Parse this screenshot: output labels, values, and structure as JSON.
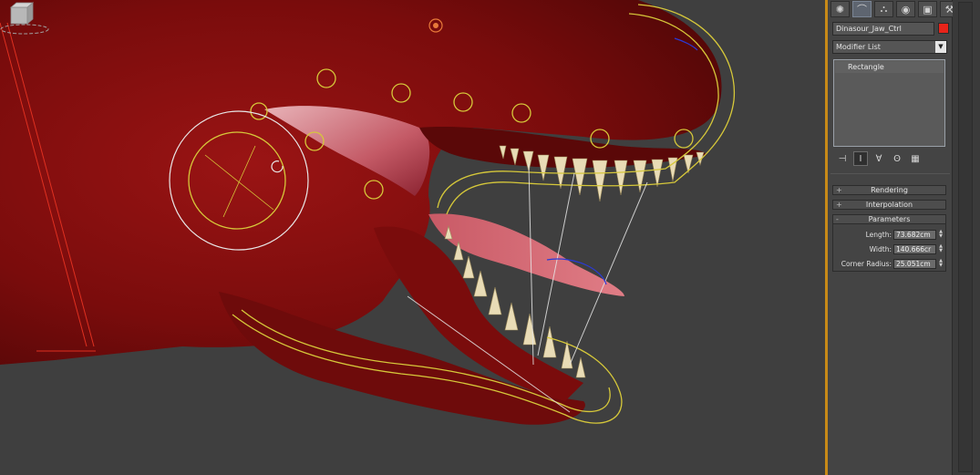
{
  "window": {
    "tabs": [
      {
        "name": "create-tab",
        "icon": "sun-icon",
        "glyph": "✺"
      },
      {
        "name": "modify-tab",
        "icon": "modify-arc-icon",
        "glyph": "⌒"
      },
      {
        "name": "hierarchy-tab",
        "icon": "hierarchy-icon",
        "glyph": "⛬"
      },
      {
        "name": "motion-tab",
        "icon": "motion-icon",
        "glyph": "◉"
      },
      {
        "name": "display-tab",
        "icon": "display-icon",
        "glyph": "▣"
      },
      {
        "name": "utilities-tab",
        "icon": "hammer-icon",
        "glyph": "⚒"
      }
    ],
    "active_tab": "modify-tab"
  },
  "object": {
    "name": "Dinasour_Jaw_Ctrl",
    "color": "#e8241a"
  },
  "modifier_list": {
    "label": "Modifier List",
    "arrow": "▼"
  },
  "stack": {
    "items": [
      "Rectangle"
    ]
  },
  "stack_tools": [
    {
      "name": "pin-stack-button",
      "glyph": "⊣"
    },
    {
      "name": "show-end-result-button",
      "glyph": "Ⅰ",
      "pressed": true
    },
    {
      "name": "make-unique-button",
      "glyph": "∀"
    },
    {
      "name": "remove-modifier-button",
      "glyph": "ʘ"
    },
    {
      "name": "configure-sets-button",
      "glyph": "▦"
    }
  ],
  "rollouts": {
    "rendering": {
      "label": "Rendering",
      "sign": "+"
    },
    "interpolation": {
      "label": "Interpolation",
      "sign": "+"
    },
    "parameters": {
      "label": "Parameters",
      "sign": "-"
    }
  },
  "parameters": {
    "length": {
      "label": "Length:",
      "value": "73.682cm"
    },
    "width": {
      "label": "Width:",
      "value": "140.666cr"
    },
    "corner_radius": {
      "label": "Corner Radius:",
      "value": "25.051cm"
    }
  },
  "viewport": {
    "background": "#3f3f3f",
    "model_color": "#8c0d0d",
    "spline_color": "#d6c83a",
    "selection_color": "#e8e8e8"
  }
}
